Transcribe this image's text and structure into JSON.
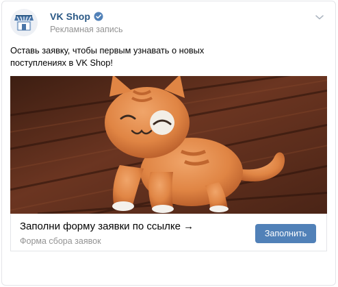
{
  "post": {
    "author": "VK Shop",
    "type_label": "Рекламная запись",
    "text_line1": "Оставь заявку, чтобы первым узнавать о новых",
    "text_line2": "поступлениях в VK Shop!"
  },
  "card": {
    "title": "Заполни форму заявки по ссылке →",
    "subtitle": "Форма сбора заявок",
    "cta_label": "Заполнить"
  },
  "colors": {
    "link_blue": "#2a5885",
    "button_blue": "#5181b8",
    "muted_gray": "#939393"
  },
  "icons": [
    "shop-logo-icon",
    "verified-icon",
    "chevron-down-icon"
  ]
}
